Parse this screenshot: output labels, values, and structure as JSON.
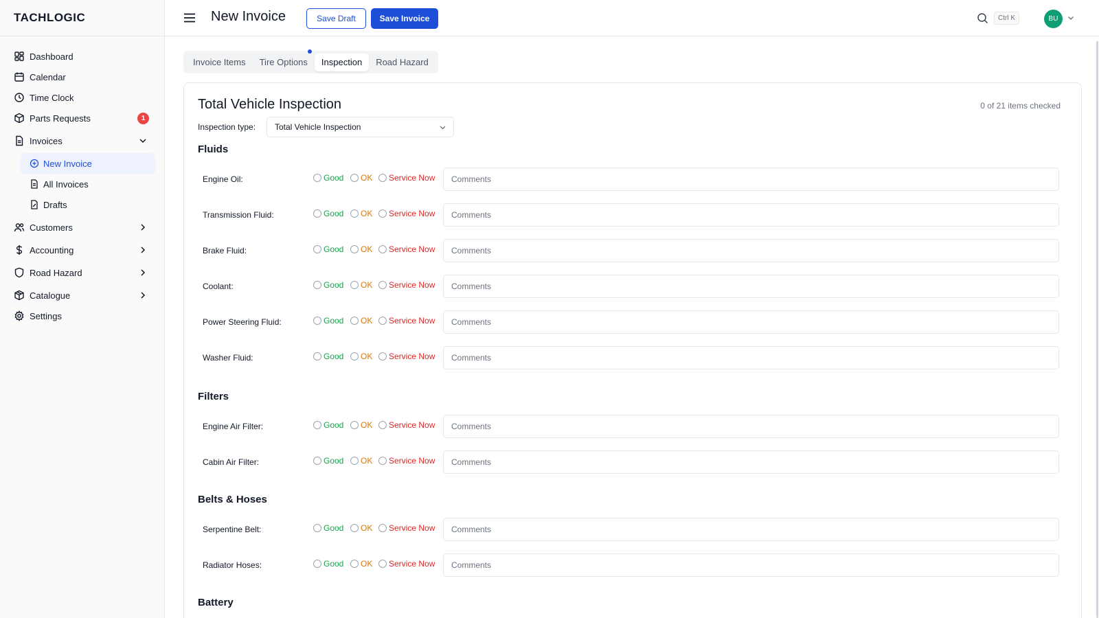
{
  "app": {
    "logo": "TACHLOGIC"
  },
  "sidebar": {
    "items": [
      {
        "label": "Dashboard",
        "icon": "dashboard-icon"
      },
      {
        "label": "Calendar",
        "icon": "calendar-icon"
      },
      {
        "label": "Time Clock",
        "icon": "clock-icon"
      },
      {
        "label": "Parts Requests",
        "icon": "package-icon",
        "badge": "1"
      },
      {
        "label": "Invoices",
        "icon": "file-icon",
        "expanded": true
      },
      {
        "label": "Customers",
        "icon": "users-icon"
      },
      {
        "label": "Accounting",
        "icon": "dollar-icon"
      },
      {
        "label": "Road Hazard",
        "icon": "shield-icon"
      },
      {
        "label": "Catalogue",
        "icon": "box-icon"
      },
      {
        "label": "Settings",
        "icon": "gear-icon"
      }
    ],
    "invoice_sub": [
      {
        "label": "New Invoice",
        "icon": "plus-circle-icon",
        "active": true
      },
      {
        "label": "All Invoices",
        "icon": "file-list-icon"
      },
      {
        "label": "Drafts",
        "icon": "file-draft-icon"
      }
    ]
  },
  "header": {
    "title": "New Invoice",
    "save_draft": "Save Draft",
    "save_invoice": "Save Invoice",
    "shortcut": "Ctrl K",
    "avatar": "BU"
  },
  "tabs": [
    {
      "label": "Invoice Items"
    },
    {
      "label": "Tire Options"
    },
    {
      "label": "Inspection",
      "active": true
    },
    {
      "label": "Road Hazard"
    }
  ],
  "inspection": {
    "title": "Total Vehicle Inspection",
    "checked": "0 of 21 items checked",
    "type_label": "Inspection type:",
    "type_value": "Total Vehicle Inspection",
    "options": {
      "good": "Good",
      "ok": "OK",
      "service": "Service Now"
    },
    "comment_placeholder": "Comments",
    "sections": [
      {
        "title": "Fluids",
        "items": [
          "Engine Oil:",
          "Transmission Fluid:",
          "Brake Fluid:",
          "Coolant:",
          "Power Steering Fluid:",
          "Washer Fluid:"
        ]
      },
      {
        "title": "Filters",
        "items": [
          "Engine Air Filter:",
          "Cabin Air Filter:"
        ]
      },
      {
        "title": "Belts & Hoses",
        "items": [
          "Serpentine Belt:",
          "Radiator Hoses:"
        ]
      },
      {
        "title": "Battery",
        "items": []
      }
    ]
  },
  "colors": {
    "accent": "#1d4ed8",
    "good": "#16a34a",
    "ok": "#d97706",
    "service": "#dc2626",
    "badge": "#ef4444",
    "avatar": "#0f9d76"
  }
}
